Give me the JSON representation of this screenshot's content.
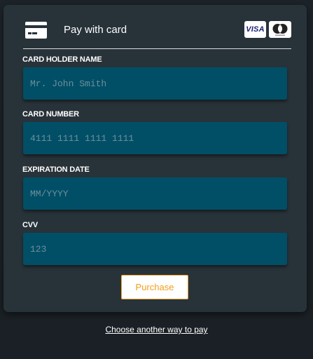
{
  "header": {
    "title": "Pay with card",
    "brands": [
      {
        "name": "VISA",
        "icon": "visa-logo"
      },
      {
        "name": "Mastercard",
        "icon": "mastercard-logo"
      }
    ]
  },
  "fields": {
    "card_holder": {
      "label": "CARD HOLDER NAME",
      "placeholder": "Mr. John Smith",
      "value": ""
    },
    "card_number": {
      "label": "CARD NUMBER",
      "placeholder": "4111 1111 1111 1111",
      "value": ""
    },
    "expiration": {
      "label": "EXPIRATION DATE",
      "placeholder": "MM/YYYY",
      "value": ""
    },
    "cvv": {
      "label": "CVV",
      "placeholder": "123",
      "value": ""
    }
  },
  "actions": {
    "purchase_label": "Purchase",
    "other_way_label": "Choose another way to pay"
  },
  "colors": {
    "background": "#1d2429",
    "card": "#283339",
    "field": "#014f66",
    "accent": "#f59d1a"
  }
}
